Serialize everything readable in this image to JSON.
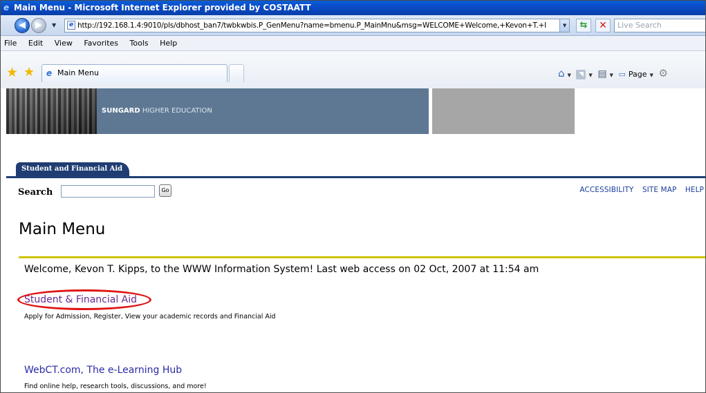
{
  "window": {
    "title": "Main Menu - Microsoft Internet Explorer provided by COSTAATT"
  },
  "address_bar": {
    "url": "http://192.168.1.4:9010/pls/dbhost_ban7/twbkwbis.P_GenMenu?name=bmenu.P_MainMnu&msg=WELCOME+Welcome,+Kevon+T.+I",
    "search_placeholder": "Live Search"
  },
  "menubar": {
    "items": [
      "File",
      "Edit",
      "View",
      "Favorites",
      "Tools",
      "Help"
    ]
  },
  "tabs": {
    "active_tab_label": "Main Menu"
  },
  "command_bar": {
    "page_label": "Page"
  },
  "banner": {
    "brand": "SUNGARD",
    "brand_suffix": "HIGHER EDUCATION"
  },
  "nav": {
    "tab_label": "Student and Financial Aid"
  },
  "search": {
    "label": "Search",
    "value": "",
    "go_label": "Go"
  },
  "top_links": [
    "ACCESSIBILITY",
    "SITE MAP",
    "HELP"
  ],
  "main": {
    "title": "Main Menu",
    "welcome": "Welcome, Kevon T. Kipps, to the WWW Information System! Last web access on 02 Oct, 2007 at 11:54 am",
    "menu_items": [
      {
        "label": "Student & Financial Aid",
        "description": "Apply for Admission, Register, View your academic records and Financial Aid"
      },
      {
        "label": "WebCT.com, The e-Learning Hub",
        "description": "Find online help, research tools, discussions, and more!"
      }
    ]
  },
  "colors": {
    "banner_blue": "#5e7893",
    "nav_navy": "#1f3d73",
    "rule_yellow": "#cfc500",
    "highlight_red": "#e01515"
  }
}
